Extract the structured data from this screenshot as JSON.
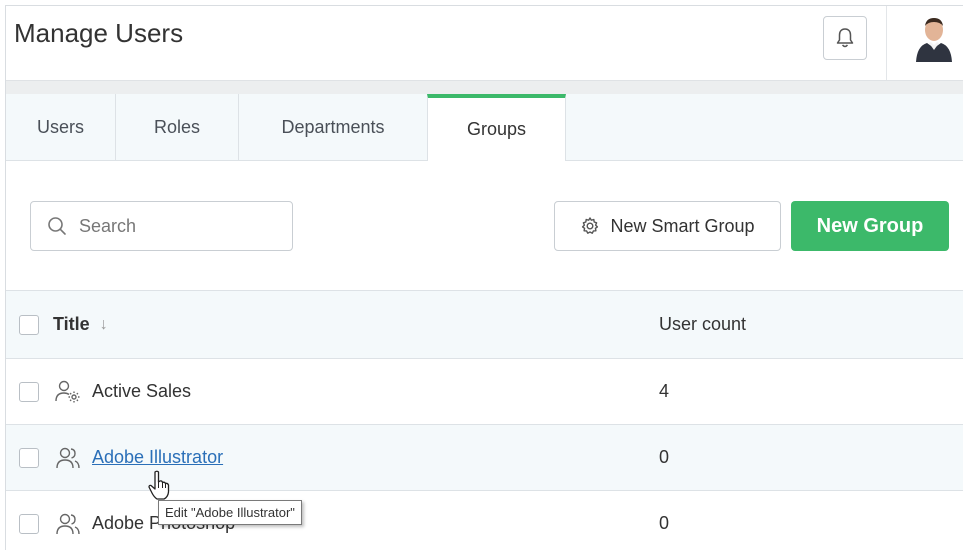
{
  "header": {
    "title": "Manage Users"
  },
  "tabs": [
    {
      "label": "Users",
      "active": false
    },
    {
      "label": "Roles",
      "active": false
    },
    {
      "label": "Departments",
      "active": false
    },
    {
      "label": "Groups",
      "active": true
    }
  ],
  "toolbar": {
    "search_placeholder": "Search",
    "smart_group_label": "New Smart Group",
    "new_group_label": "New Group"
  },
  "table": {
    "columns": [
      "Title",
      "User count"
    ],
    "rows": [
      {
        "title": "Active Sales",
        "user_count": "4",
        "icon": "smart-group-icon"
      },
      {
        "title": "Adobe Illustrator",
        "user_count": "0",
        "icon": "group-icon"
      },
      {
        "title": "Adobe Photoshop",
        "user_count": "0",
        "icon": "group-icon"
      }
    ]
  },
  "tooltip": {
    "text": "Edit \"Adobe Illustrator\""
  },
  "colors": {
    "accent_green": "#3cb96a",
    "link_blue": "#2a6fb8",
    "tab_bg": "#f4f9fb"
  }
}
